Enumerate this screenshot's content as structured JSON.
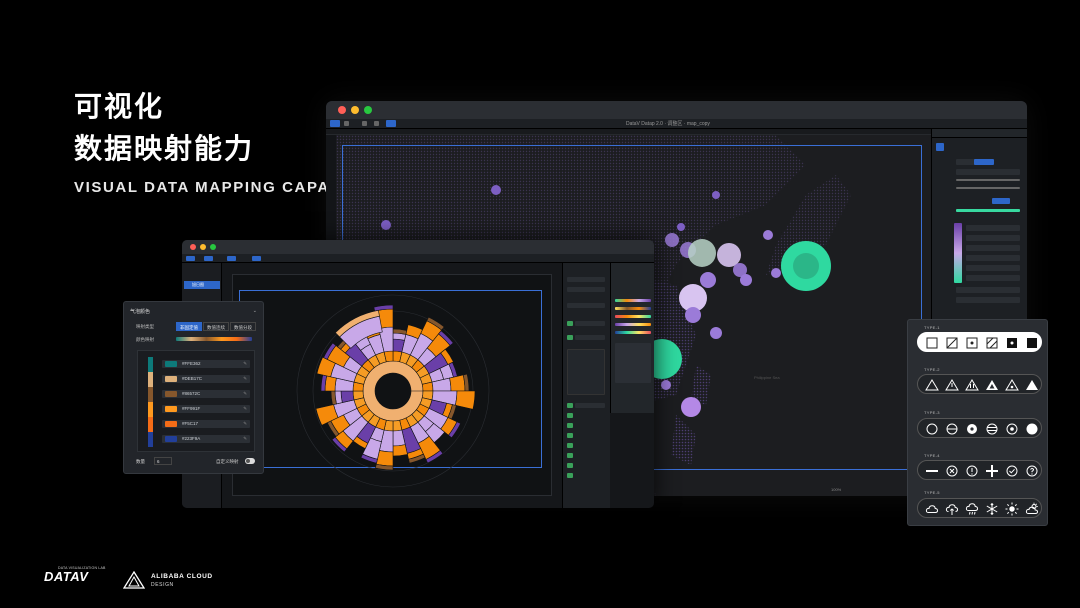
{
  "heading": {
    "line1": "可视化",
    "line2": "数据映射能力",
    "subtitle": "VISUAL DATA MAPPING CAPABILITY"
  },
  "brand": {
    "datav": "DATAV",
    "datav_sub": "DATA VISUALIZATION LAB",
    "alibaba_line1": "ALIBABA CLOUD",
    "alibaba_line2": "DESIGN"
  },
  "map_window": {
    "title": "DataV Datap 2.0 · 调整区 · map_copy",
    "map_label": "Philippine Sea",
    "status": "100%"
  },
  "mid_window": {
    "layer_item": "旭日图"
  },
  "color_panel": {
    "title": "气泡颜色",
    "mapping_type_label": "映射类型",
    "tabs": [
      "非固定值",
      "数值连续",
      "数值分段"
    ],
    "gradient_label": "颜色映射",
    "colors": [
      {
        "hex": "#FFE362",
        "swatch": "#0d7a7a"
      },
      {
        "hex": "#DEB17C",
        "swatch": "#deb17c"
      },
      {
        "hex": "#86572C",
        "swatch": "#86572c"
      },
      {
        "hex": "#FF991F",
        "swatch": "#ff991f"
      },
      {
        "hex": "#F5C17",
        "swatch": "#f56c17"
      },
      {
        "hex": "#223F9A",
        "swatch": "#223f9a"
      }
    ],
    "count_label": "数量",
    "count_value": "6",
    "custom_label": "自定义映射"
  },
  "icon_panel": {
    "type_labels": [
      "TYPE-1",
      "TYPE-2",
      "TYPE-3",
      "TYPE-4",
      "TYPE-5"
    ],
    "rows": [
      [
        "square-outline",
        "square-slash",
        "square-dot",
        "square-hatch",
        "square-filled-dot",
        "square-filled"
      ],
      [
        "triangle-outline",
        "triangle-alert",
        "triangle-alert-bold",
        "triangle-filled-outline",
        "triangle-dot",
        "triangle-filled"
      ],
      [
        "circle-outline",
        "circle-minus-line",
        "circle-dot",
        "circle-grid",
        "circle-target",
        "circle-filled"
      ],
      [
        "minus",
        "circle-x",
        "circle-exclaim",
        "plus",
        "circle-check",
        "circle-question"
      ],
      [
        "cloud",
        "cloud-upload",
        "cloud-rain",
        "snowflake",
        "sun",
        "cloud-sun"
      ]
    ]
  },
  "colors": {
    "accent_blue": "#2d66c9",
    "bubble_purple": "#9b7bd8",
    "bubble_green": "#2fd9a0",
    "sunburst_orange": "#f58a0a",
    "sunburst_lavender": "#c8a8e8",
    "sunburst_purple": "#6a3fa8"
  }
}
